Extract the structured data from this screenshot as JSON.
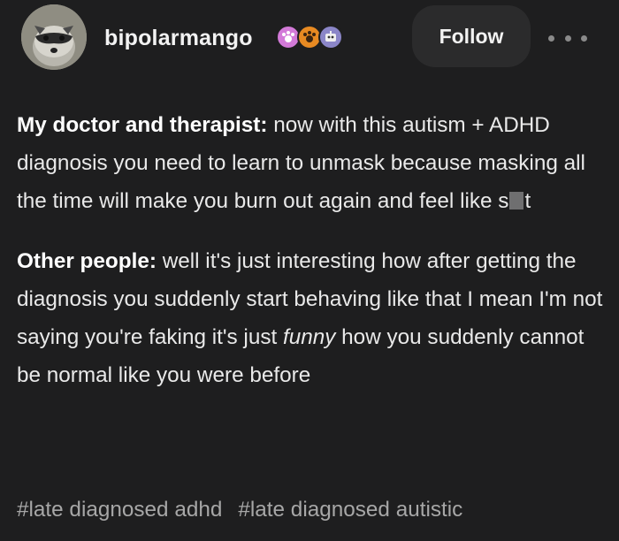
{
  "post_header": {
    "username": "bipolarmango",
    "badges": [
      {
        "icon": "paw-badge-icon",
        "color": "#d37ad8"
      },
      {
        "icon": "paw-badge-icon",
        "color": "#e88a22"
      },
      {
        "icon": "robot-badge-icon",
        "color": "#8b86c8"
      }
    ],
    "follow_label": "Follow"
  },
  "post_body": {
    "para1": {
      "speaker": "My doctor and therapist:",
      "text": " now with this autism + ADHD diagnosis you need to learn to unmask because masking all the time will make you burn out again and feel like s",
      "end": "t"
    },
    "para2": {
      "speaker": "Other people:",
      "text": " well it's just interesting how after getting the diagnosis you suddenly start behaving like that I mean I'm not saying you're faking it's just ",
      "emphasis": "funny",
      "end": " how you suddenly cannot be normal like you were before"
    }
  },
  "tags": [
    "#late diagnosed adhd",
    "#late diagnosed autistic"
  ]
}
